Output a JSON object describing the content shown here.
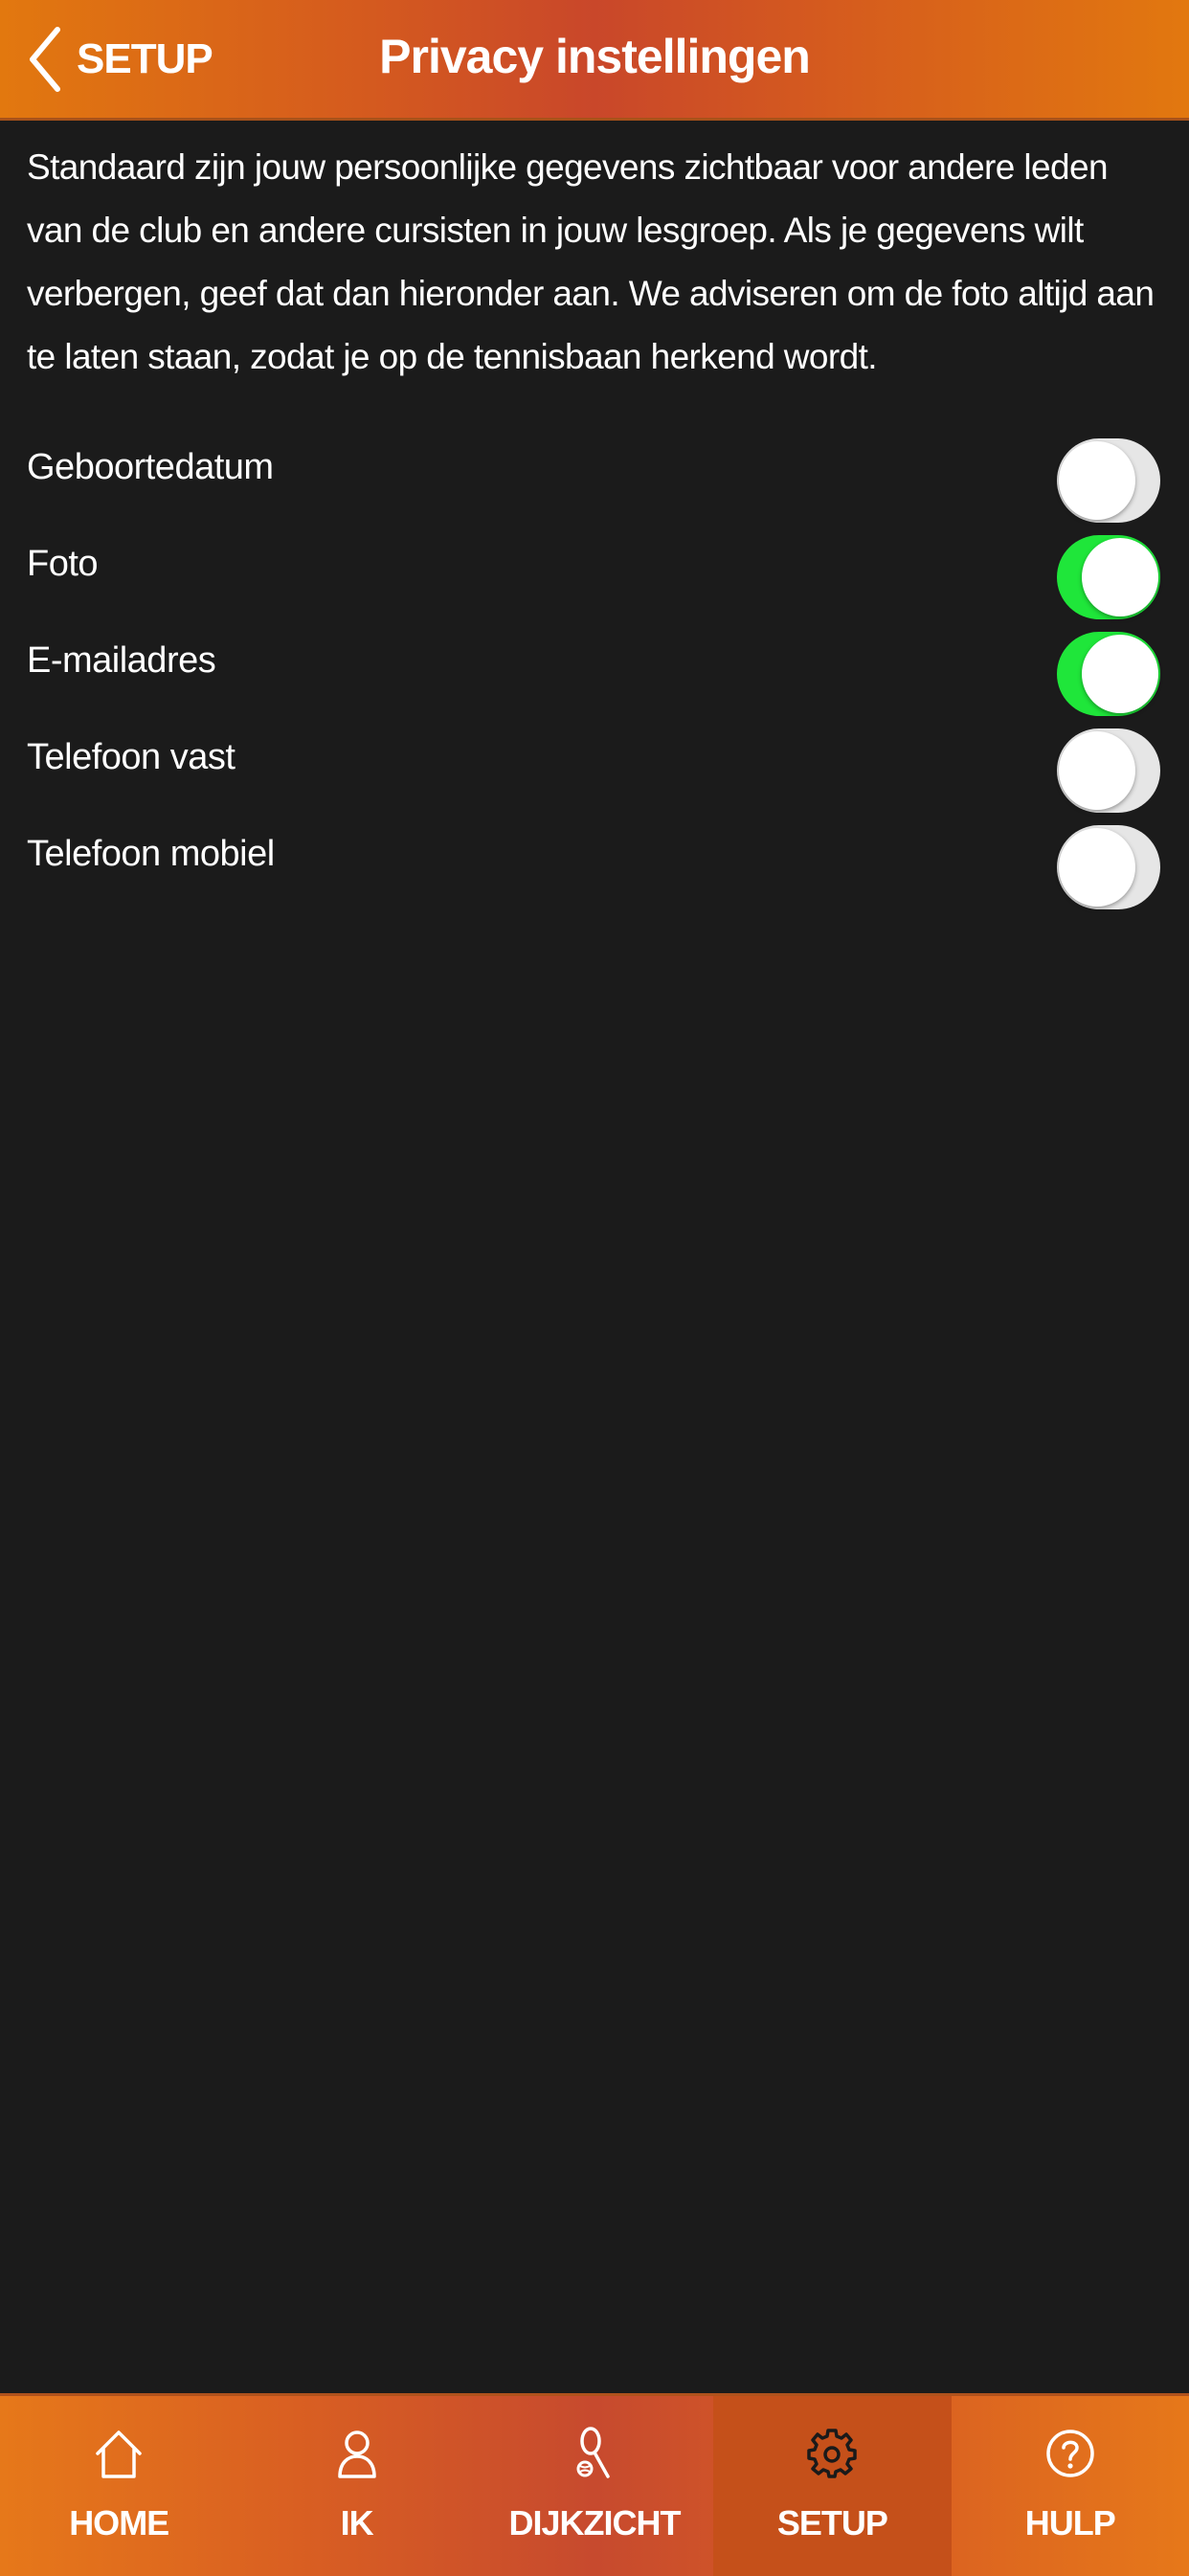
{
  "header": {
    "back_label": "SETUP",
    "title": "Privacy instellingen"
  },
  "intro": "Standaard zijn jouw persoonlijke gegevens zichtbaar voor andere leden van de club en andere cursisten in jouw lesgroep. Als je gegevens wilt verbergen, geef dat dan hieronder aan. We adviseren om de foto altijd aan te laten staan, zodat je op de tennisbaan herkend wordt.",
  "settings": [
    {
      "label": "Geboortedatum",
      "on": false
    },
    {
      "label": "Foto",
      "on": true
    },
    {
      "label": "E-mailadres",
      "on": true
    },
    {
      "label": "Telefoon vast",
      "on": false
    },
    {
      "label": "Telefoon mobiel",
      "on": false
    }
  ],
  "tabs": [
    {
      "label": "HOME",
      "icon": "home-icon",
      "active": false
    },
    {
      "label": "IK",
      "icon": "person-icon",
      "active": false
    },
    {
      "label": "DIJKZICHT",
      "icon": "tennis-racket-icon",
      "active": false
    },
    {
      "label": "SETUP",
      "icon": "gear-icon",
      "active": true
    },
    {
      "label": "HULP",
      "icon": "help-icon",
      "active": false
    }
  ],
  "colors": {
    "accent": "#d95f22",
    "toggle_on": "#1fe63a",
    "toggle_off": "#e6e6e6",
    "background": "#1b1b1b"
  }
}
